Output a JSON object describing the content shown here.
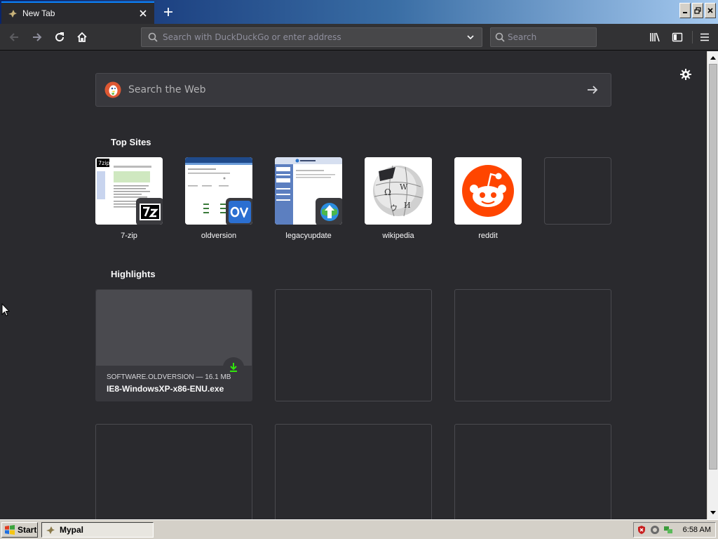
{
  "tab": {
    "title": "New Tab"
  },
  "toolbar": {
    "url_placeholder": "Search with DuckDuckGo or enter address",
    "search_placeholder": "Search"
  },
  "newtab": {
    "websearch_placeholder": "Search the Web",
    "top_sites_title": "Top Sites",
    "top_sites": [
      {
        "label": "7-zip",
        "icon": "7zip-icon"
      },
      {
        "label": "oldversion",
        "icon": "oldversion-icon"
      },
      {
        "label": "legacyupdate",
        "icon": "legacyupdate-icon"
      },
      {
        "label": "wikipedia",
        "icon": "wikipedia-icon"
      },
      {
        "label": "reddit",
        "icon": "reddit-icon"
      }
    ],
    "highlights_title": "Highlights",
    "highlight": {
      "meta": "SOFTWARE.OLDVERSION — 16.1 MB",
      "filename": "IE8-WindowsXP-x86-ENU.exe"
    }
  },
  "taskbar": {
    "start_label": "Start",
    "task_label": "Mypal",
    "clock": "6:58 AM"
  },
  "colors": {
    "background": "#2a2a2e",
    "toolbar": "#323234",
    "accent": "#0a84ff",
    "reddit": "#ff4500",
    "download_green": "#30e60b"
  }
}
